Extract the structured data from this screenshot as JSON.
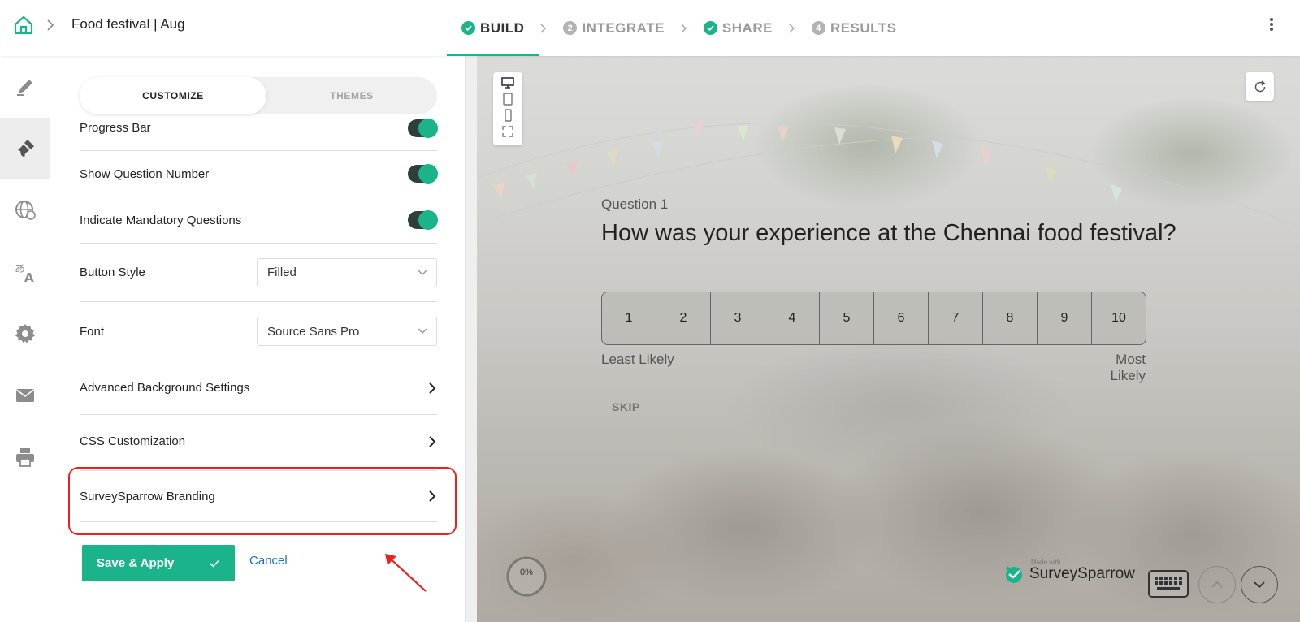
{
  "header": {
    "title": "Food festival | Aug",
    "steps": [
      {
        "label": "BUILD",
        "state": "done"
      },
      {
        "label": "INTEGRATE",
        "number": "2"
      },
      {
        "label": "SHARE",
        "state": "done"
      },
      {
        "label": "RESULTS",
        "number": "4"
      }
    ],
    "active_step": "BUILD"
  },
  "rail": {
    "items": [
      "edit-icon",
      "paint-brush-icon",
      "globe-icon",
      "translate-icon",
      "gear-icon",
      "mail-icon",
      "printer-icon"
    ],
    "active": "paint-brush-icon"
  },
  "panel": {
    "tabs": {
      "customize": "CUSTOMIZE",
      "themes": "THEMES"
    },
    "toggles": [
      {
        "label": "Progress Bar",
        "on": true
      },
      {
        "label": "Show Question Number",
        "on": true
      },
      {
        "label": "Indicate Mandatory Questions",
        "on": true
      }
    ],
    "button_style": {
      "label": "Button Style",
      "value": "Filled"
    },
    "font": {
      "label": "Font",
      "value": "Source Sans Pro"
    },
    "links": {
      "advanced_bg": "Advanced Background Settings",
      "css": "CSS Customization",
      "branding": "SurveySparrow Branding"
    },
    "save_label": "Save & Apply",
    "cancel_label": "Cancel"
  },
  "preview": {
    "question_label": "Question 1",
    "question_text": "How was your experience at the Chennai food festival?",
    "scale": [
      "1",
      "2",
      "3",
      "4",
      "5",
      "6",
      "7",
      "8",
      "9",
      "10"
    ],
    "least_label": "Least Likely",
    "most_label": "Most Likely",
    "skip_label": "SKIP",
    "progress_text": "0%",
    "progress_value": 0,
    "brand_small": "Made with",
    "brand_name": "SurveySparrow"
  },
  "colors": {
    "accent": "#1bb389",
    "highlight": "#e8231f",
    "link": "#1a6fd1"
  }
}
